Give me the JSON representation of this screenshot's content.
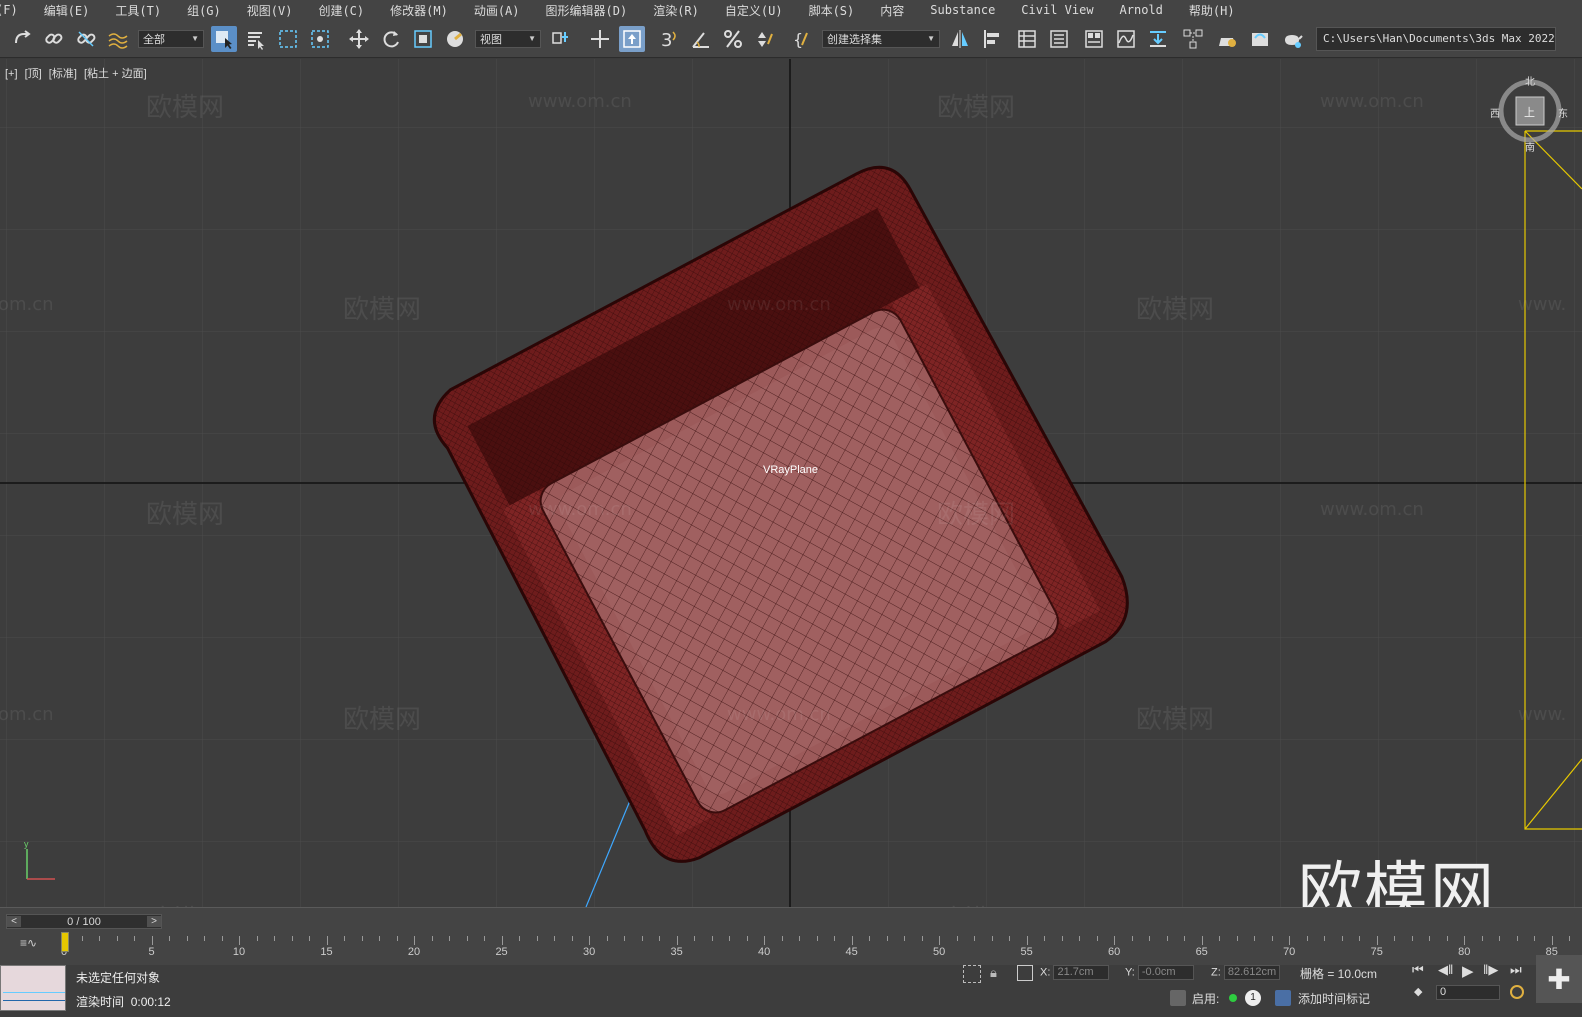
{
  "menu": [
    "(F)",
    "编辑(E)",
    "工具(T)",
    "组(G)",
    "视图(V)",
    "创建(C)",
    "修改器(M)",
    "动画(A)",
    "图形编辑器(D)",
    "渲染(R)",
    "自定义(U)",
    "脚本(S)",
    "内容",
    "Substance",
    "Civil View",
    "Arnold",
    "帮助(H)"
  ],
  "toolbar": {
    "selection_filter": "全部",
    "ref_coord": "视图",
    "named_selection": "创建选择集",
    "angle_snap_label": "3",
    "project_path": "C:\\Users\\Han\\Documents\\3ds Max 2022"
  },
  "viewport": {
    "labels": [
      "[+]",
      "[顶]",
      "[标准]",
      "[粘土 + 边面]"
    ],
    "object_label": "VRayPlane",
    "viewcube": {
      "north": "北",
      "west": "西",
      "east": "东",
      "south": "南",
      "face": "上"
    },
    "watermark_text": "欧模网",
    "watermark_url": "www.om.cn",
    "watermark_url_partial": "om.cn",
    "watermark_url_partial_right": "www.",
    "logo_text": "欧模网",
    "colors": {
      "background": "#3d3d3d",
      "grid": "#4a4a4a",
      "model": "#8a2a2a",
      "selection": "#e6c800"
    }
  },
  "timeline": {
    "frame_display": "0 / 100",
    "ticks": [
      "0",
      "5",
      "10",
      "15",
      "20",
      "25",
      "30",
      "35",
      "40",
      "45",
      "50",
      "55",
      "60",
      "65",
      "70",
      "75",
      "80",
      "85"
    ]
  },
  "status": {
    "selection_text": "未选定任何对象",
    "render_time_label": "渲染时间",
    "render_time_value": "0:00:12",
    "x_label": "X:",
    "x_value": "21.7cm",
    "y_label": "Y:",
    "y_value": "-0.0cm",
    "z_label": "Z:",
    "z_value": "82.612cm",
    "grid_text": "栅格 = 10.0cm",
    "enable_label": "启用:",
    "enable_count": "1",
    "add_time_tag": "添加时间标记",
    "frame_input": "0"
  }
}
